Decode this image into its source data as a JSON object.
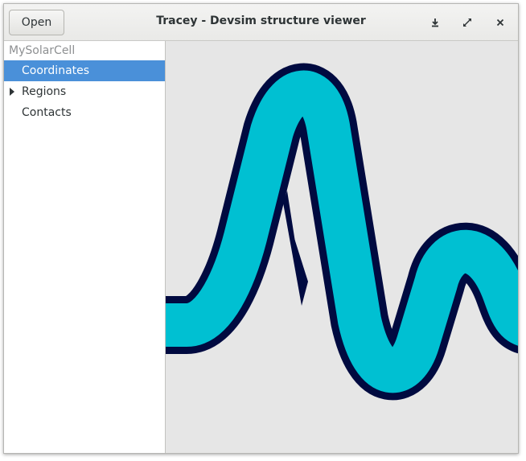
{
  "window": {
    "title": "Tracey - Devsim structure viewer",
    "open_label": "Open",
    "buttons": [
      {
        "icon": "download-icon"
      },
      {
        "icon": "maximize-icon"
      },
      {
        "icon": "close-icon"
      }
    ]
  },
  "sidebar": {
    "root": "MySolarCell",
    "items": [
      {
        "label": "Coordinates",
        "selected": true,
        "expandable": false
      },
      {
        "label": "Regions",
        "selected": false,
        "expandable": true
      },
      {
        "label": "Contacts",
        "selected": false,
        "expandable": false
      }
    ]
  },
  "canvas": {
    "background": "#e6e6e6",
    "logo_fill": "#00c0d2",
    "logo_stroke": "#000a40",
    "logo_icon": "pulse-logo-icon"
  },
  "colors": {
    "selection": "#4a90d9",
    "text": "#2e3436",
    "muted": "#8e9092"
  }
}
